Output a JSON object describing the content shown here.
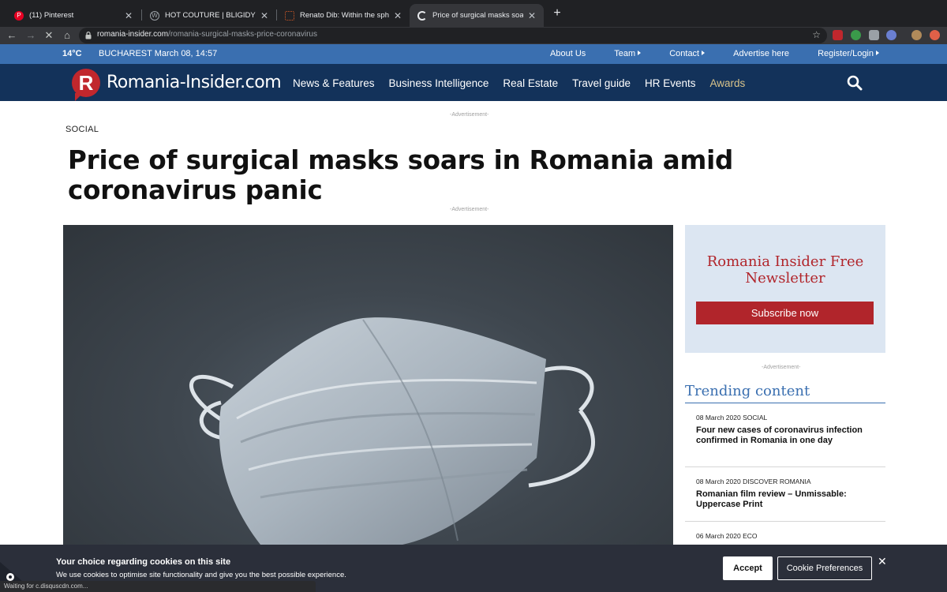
{
  "browser": {
    "tabs": [
      {
        "title": "(11) Pinterest",
        "favicon": "pinterest-icon",
        "color": "#e60023"
      },
      {
        "title": "HOT COUTURE | BLIGIDYBLOG",
        "favicon": "wordpress-icon",
        "color": "#5f6368"
      },
      {
        "title": "Renato Dib: Within the sphere of",
        "favicon": "grid-icon",
        "color": "#d35a26"
      },
      {
        "title": "Price of surgical masks soars in R",
        "favicon": "loading-icon",
        "color": "#e8eaed"
      }
    ],
    "url_domain": "romania-insider.com",
    "url_path": "/romania-surgical-masks-price-coronavirus"
  },
  "topbar": {
    "temperature": "14°C",
    "location_date": "BUCHAREST March 08, 14:57",
    "links": [
      "About Us",
      "Team",
      "Contact",
      "Advertise here",
      "Register/Login"
    ],
    "links_with_caret": [
      false,
      true,
      true,
      false,
      true
    ]
  },
  "nav": {
    "logo_letter": "R",
    "logo_text": "Romania-Insider.com",
    "items": [
      "News & Features",
      "Business Intelligence",
      "Real Estate",
      "Travel guide",
      "HR Events",
      "Awards"
    ],
    "accent_color": "#d8c38a"
  },
  "article": {
    "ad_label": "-Advertisement-",
    "category": "SOCIAL",
    "headline": "Price of surgical masks soars in Romania amid coronavirus panic"
  },
  "sidebar": {
    "newsletter_title": "Romania Insider Free Newsletter",
    "subscribe_label": "Subscribe now",
    "ad_label": "-Advertisement-",
    "trending_title": "Trending content",
    "trending": [
      {
        "date": "08 March 2020",
        "category": "SOCIAL",
        "headline": "Four new cases of coronavirus infection confirmed in Romania in one day"
      },
      {
        "date": "08 March 2020",
        "category": "DISCOVER ROMANIA",
        "headline": "Romanian film review – Unmissable: Uppercase Print"
      },
      {
        "date": "06 March 2020",
        "category": "ECO",
        "headline": ""
      }
    ]
  },
  "cookie": {
    "title": "Your choice regarding cookies on this site",
    "text": "We use cookies to optimise site functionality and give you the best possible experience.",
    "accept_label": "Accept",
    "preferences_label": "Cookie Preferences"
  },
  "status": "Waiting for c.disquscdn.com..."
}
